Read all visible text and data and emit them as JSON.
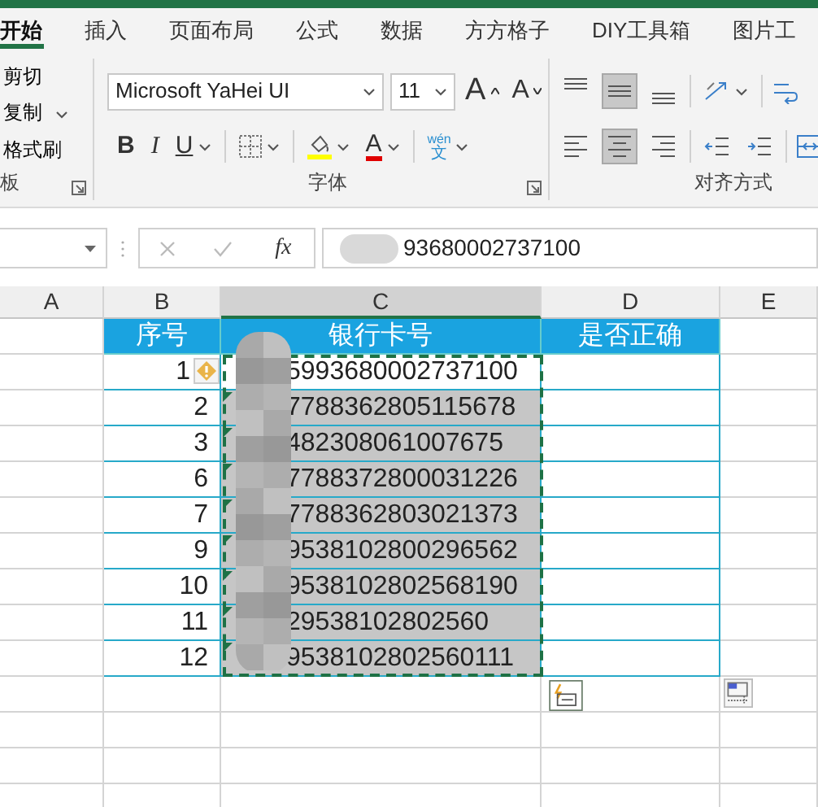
{
  "tabs": [
    {
      "label": "开始",
      "selected": true
    },
    {
      "label": "插入",
      "selected": false
    },
    {
      "label": "页面布局",
      "selected": false
    },
    {
      "label": "公式",
      "selected": false
    },
    {
      "label": "数据",
      "selected": false
    },
    {
      "label": "方方格子",
      "selected": false
    },
    {
      "label": "DIY工具箱",
      "selected": false
    },
    {
      "label": "图片工",
      "selected": false
    }
  ],
  "clipboard": {
    "items": [
      {
        "label": "剪切",
        "dropdown": false
      },
      {
        "label": "复制",
        "dropdown": true
      },
      {
        "label": "格式刷",
        "dropdown": false
      }
    ],
    "group_label": "板"
  },
  "font": {
    "font_name": "Microsoft YaHei UI",
    "font_size": "11",
    "grow_label": "A",
    "shrink_label": "A",
    "bold_label": "B",
    "italic_label": "I",
    "underline_label": "U",
    "font_color_label": "A",
    "phonetic_top": "wén",
    "phonetic_bottom": "文",
    "group_label": "字体"
  },
  "alignment": {
    "vertical": [
      {
        "kind": "top",
        "selected": false
      },
      {
        "kind": "middle",
        "selected": true
      },
      {
        "kind": "bottom",
        "selected": false
      }
    ],
    "horizontal": [
      {
        "kind": "left",
        "selected": false
      },
      {
        "kind": "center",
        "selected": true
      },
      {
        "kind": "right",
        "selected": false
      }
    ],
    "group_label": "对齐方式"
  },
  "formula_bar": {
    "function_label": "fx",
    "value": "93680002737100"
  },
  "columns": [
    {
      "label": "A",
      "selected": false
    },
    {
      "label": "B",
      "selected": false
    },
    {
      "label": "C",
      "selected": true
    },
    {
      "label": "D",
      "selected": false
    },
    {
      "label": "E",
      "selected": false
    }
  ],
  "table": {
    "headers": [
      "序号",
      "银行卡号",
      "是否正确"
    ],
    "rows": [
      {
        "no": "1",
        "card": "5993680002737100",
        "warning": true,
        "active": true,
        "flagged": false
      },
      {
        "no": "2",
        "card": "7788362805115678",
        "warning": false,
        "active": false,
        "flagged": true
      },
      {
        "no": "3",
        "card": "482308061007675",
        "warning": false,
        "active": false,
        "flagged": true
      },
      {
        "no": "6",
        "card": "7788372800031226",
        "warning": false,
        "active": false,
        "flagged": true
      },
      {
        "no": "7",
        "card": "7788362803021373",
        "warning": false,
        "active": false,
        "flagged": true
      },
      {
        "no": "9",
        "card": "9538102800296562",
        "warning": false,
        "active": false,
        "flagged": true
      },
      {
        "no": "10",
        "card": "9538102802568190",
        "warning": false,
        "active": false,
        "flagged": true
      },
      {
        "no": "11",
        "card": "29538102802560",
        "warning": false,
        "active": false,
        "flagged": true
      },
      {
        "no": "12",
        "card": "9538102802560111",
        "warning": false,
        "active": false,
        "flagged": true
      }
    ]
  }
}
